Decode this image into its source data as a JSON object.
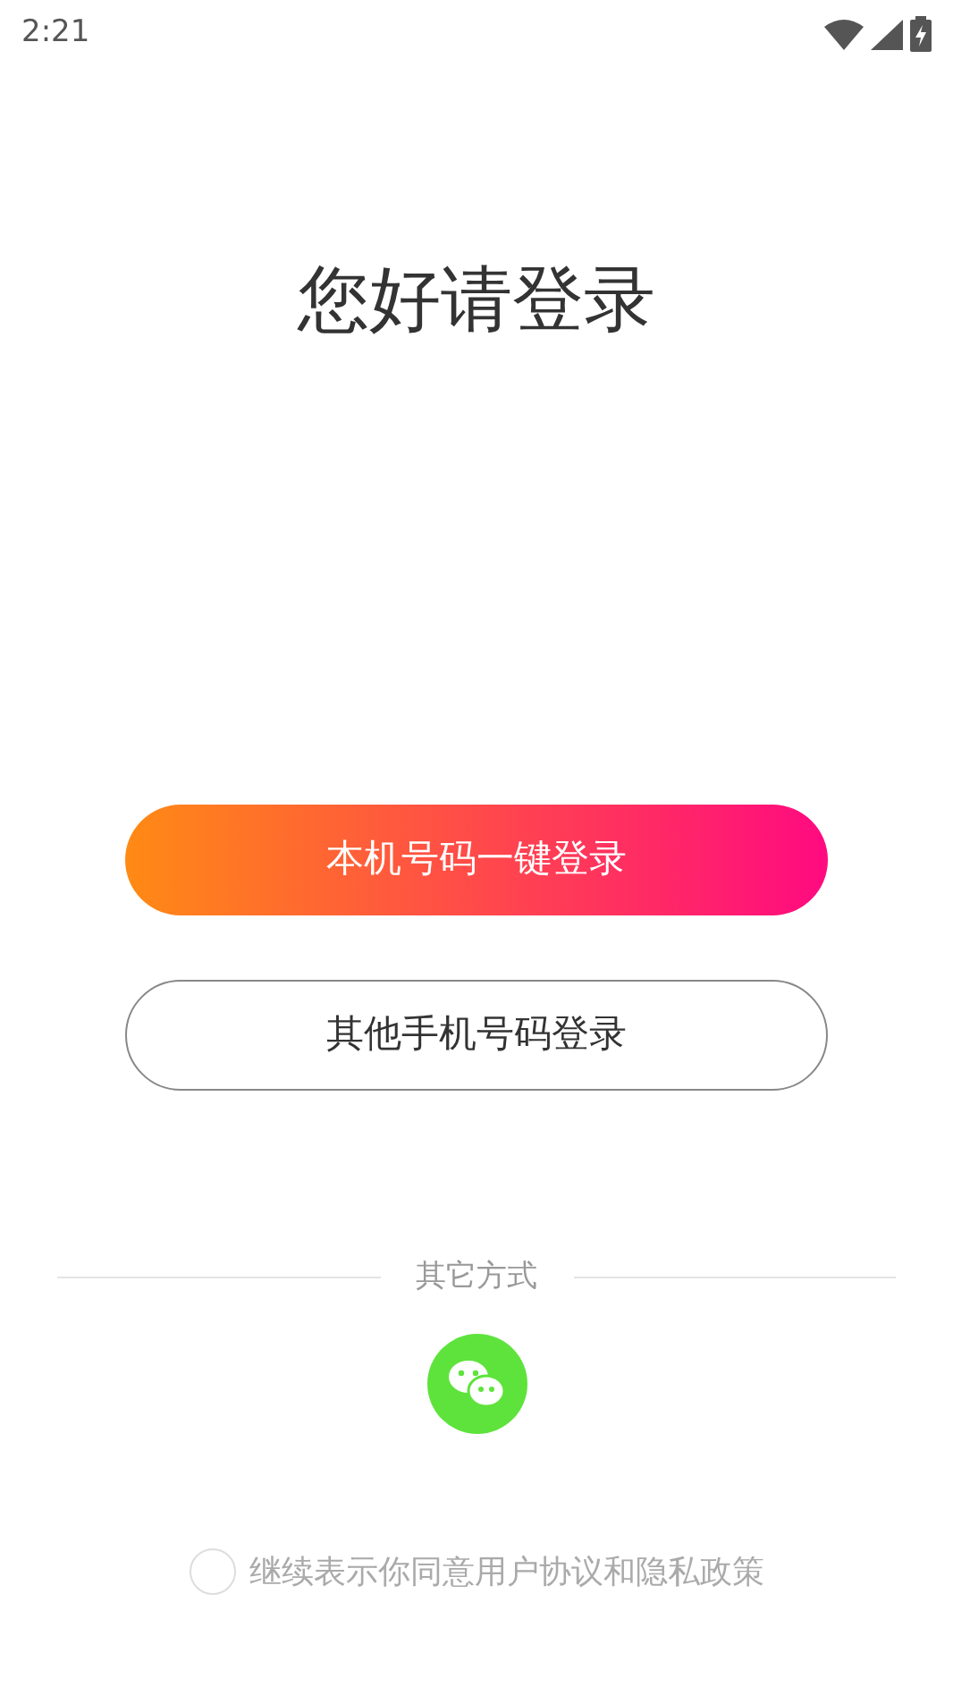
{
  "status_bar": {
    "time": "2:21"
  },
  "title": "您好请登录",
  "buttons": [
    {
      "kind": "gradient",
      "label": "本机号码一键登录"
    },
    {
      "kind": "outline",
      "label": "其他手机号码登录"
    }
  ],
  "other_methods": {
    "label": "其它方式"
  },
  "agreement": {
    "checked": false,
    "text": "继续表示你同意用户协议和隐私政策"
  }
}
